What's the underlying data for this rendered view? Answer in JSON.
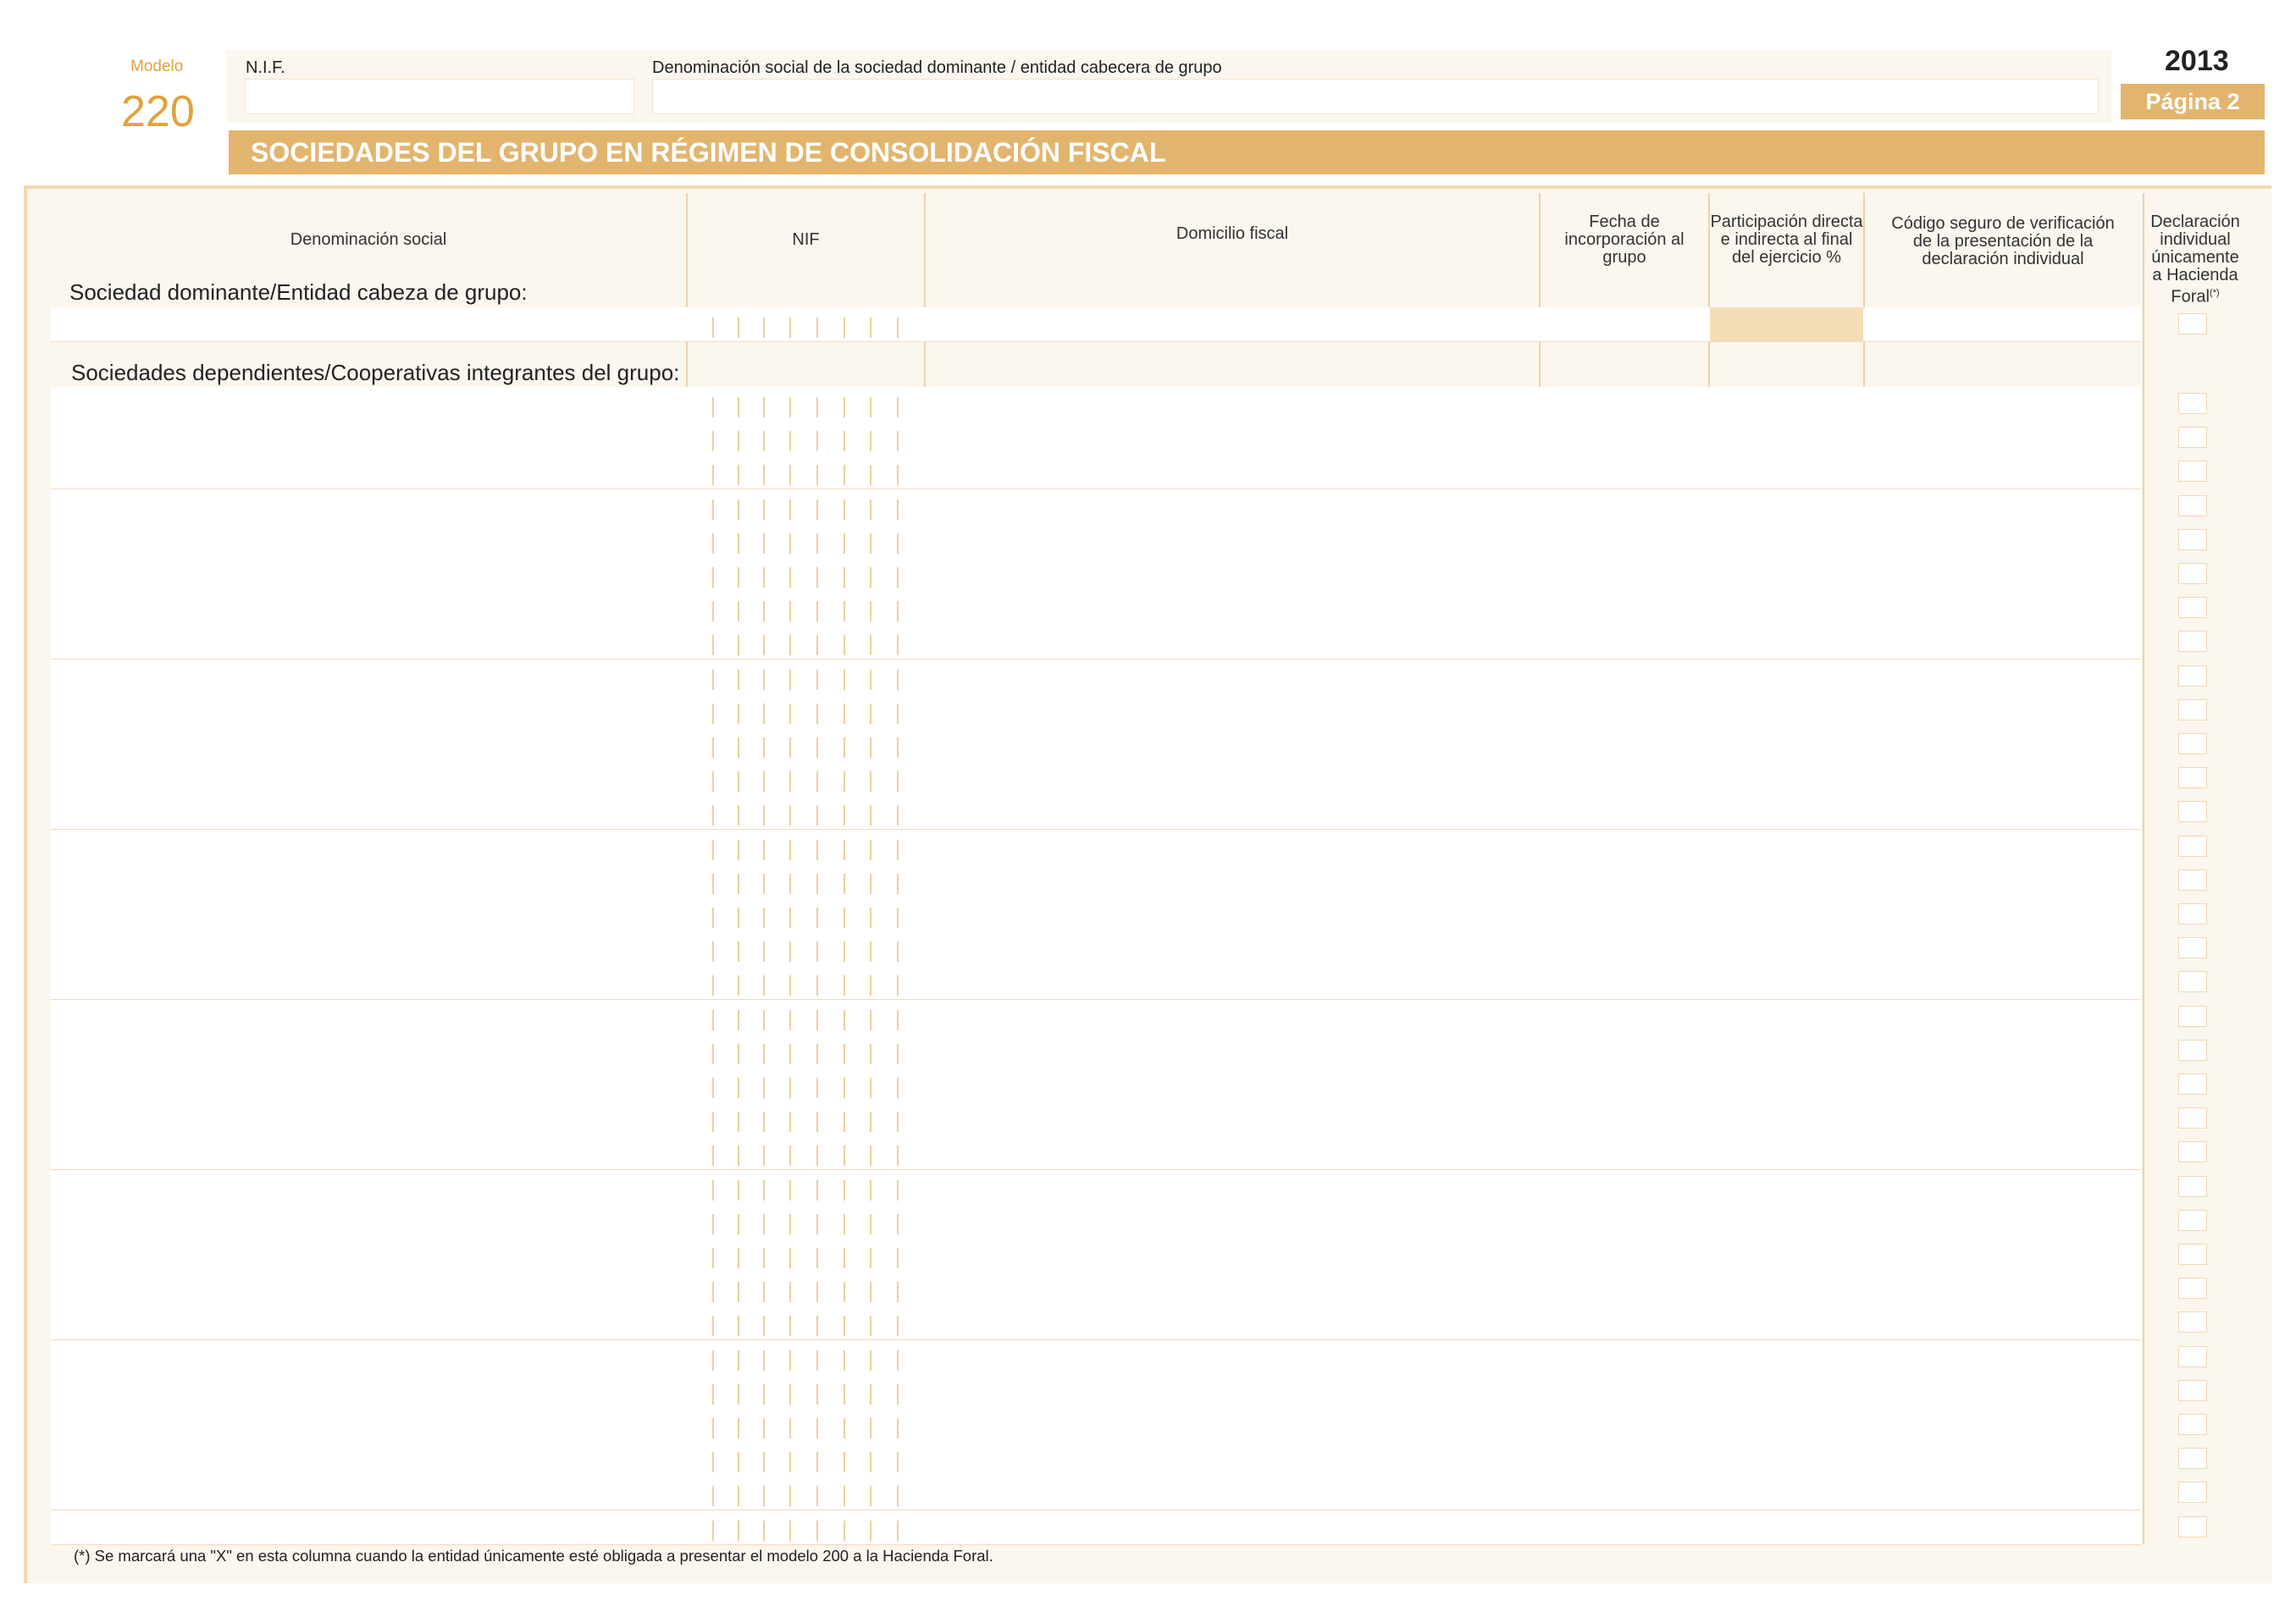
{
  "header": {
    "modelo_label": "Modelo",
    "modelo_number": "220",
    "nif_label": "N.I.F.",
    "nif_value": "",
    "denominacion_label": "Denominación social de la sociedad dominante / entidad cabecera de grupo",
    "denominacion_value": "",
    "year": "2013",
    "page_label": "Página 2"
  },
  "title": "SOCIEDADES DEL GRUPO EN RÉGIMEN DE CONSOLIDACIÓN FISCAL",
  "columns": {
    "denominacion": "Denominación social",
    "nif": "NIF",
    "domicilio": "Domicilio fiscal",
    "fecha": "Fecha de incorporación al grupo",
    "participacion": "Participación directa e indirecta al final del ejercicio %",
    "codigo": "Código seguro de verificación de la presentación de la declaración individual",
    "declaracion": "Declaración individual únicamente a Hacienda Foral",
    "declaracion_note_mark": "(*)"
  },
  "sections": {
    "dominante_label": "Sociedad dominante/Entidad cabeza de grupo:",
    "dependientes_label": "Sociedades dependientes/Cooperativas integrantes del grupo:"
  },
  "footnote": "(*) Se marcará una \"X\" en esta columna cuando la entidad únicamente esté obligada a presentar el modelo 200 a la Hacienda Foral.",
  "colors": {
    "accent": "#e2b56e",
    "accent_text": "#e0a33d",
    "panel": "#fbf6ee",
    "rule": "#ecd3a8"
  }
}
